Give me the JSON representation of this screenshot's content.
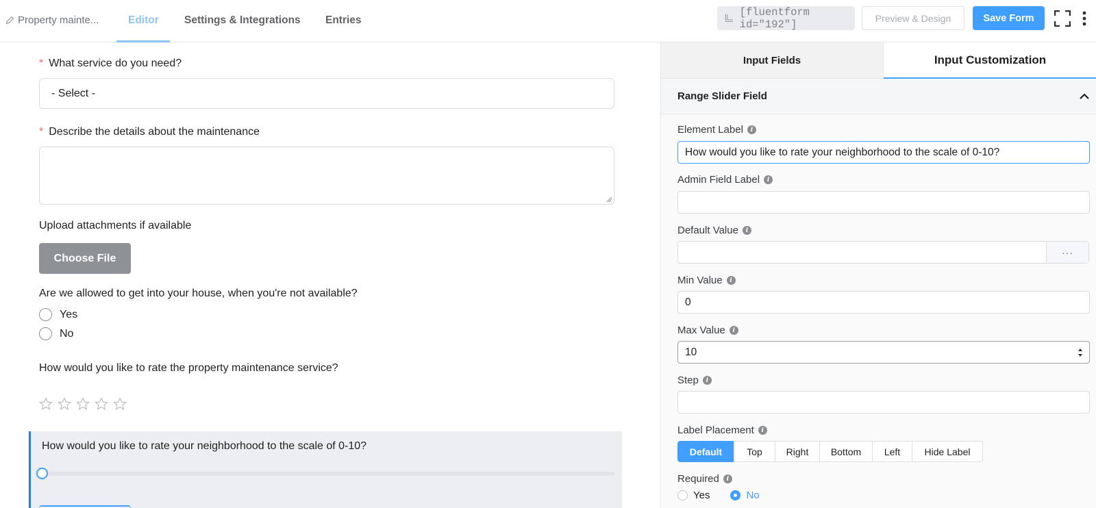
{
  "header": {
    "form_title": "Property mainte...",
    "tabs": [
      {
        "label": "Editor",
        "active": true
      },
      {
        "label": "Settings & Integrations",
        "active": false
      },
      {
        "label": "Entries",
        "active": false
      }
    ],
    "shortcode": "[fluentform id=\"192\"]",
    "preview_label": "Preview & Design",
    "save_label": "Save Form"
  },
  "form": {
    "service": {
      "label": "What service do you need?",
      "required": "*",
      "placeholder": "- Select -"
    },
    "details": {
      "label": "Describe the details about the maintenance",
      "required": "*"
    },
    "upload": {
      "label": "Upload attachments if available",
      "button": "Choose File"
    },
    "access": {
      "label": "Are we allowed to get into your house, when you're not available?",
      "options": [
        "Yes",
        "No"
      ]
    },
    "rating": {
      "label": "How would you like to rate the property maintenance service?",
      "stars": 5,
      "value": 0
    },
    "slider": {
      "label": "How would you like to rate your neighborhood to the scale of 0-10?",
      "min": 0,
      "max": 10,
      "value": 0
    }
  },
  "panel": {
    "tabs": [
      "Input Fields",
      "Input Customization"
    ],
    "active_tab": "Input Customization",
    "section_title": "Range Slider Field",
    "fields": {
      "element_label": {
        "label": "Element Label",
        "value": "How would you like to rate your neighborhood to the scale of 0-10?"
      },
      "admin_label": {
        "label": "Admin Field Label",
        "value": ""
      },
      "default_value": {
        "label": "Default Value",
        "value": "",
        "addon": "···"
      },
      "min_value": {
        "label": "Min Value",
        "value": "0"
      },
      "max_value": {
        "label": "Max Value",
        "value": "10"
      },
      "step": {
        "label": "Step",
        "value": ""
      },
      "label_placement": {
        "label": "Label Placement",
        "options": [
          "Default",
          "Top",
          "Right",
          "Bottom",
          "Left",
          "Hide Label"
        ],
        "selected": "Default"
      },
      "required": {
        "label": "Required",
        "options": [
          "Yes",
          "No"
        ],
        "selected": "No"
      }
    }
  },
  "colors": {
    "accent": "#409eff",
    "required": "#f56c6c",
    "tab_active": "#8ec3f0"
  }
}
